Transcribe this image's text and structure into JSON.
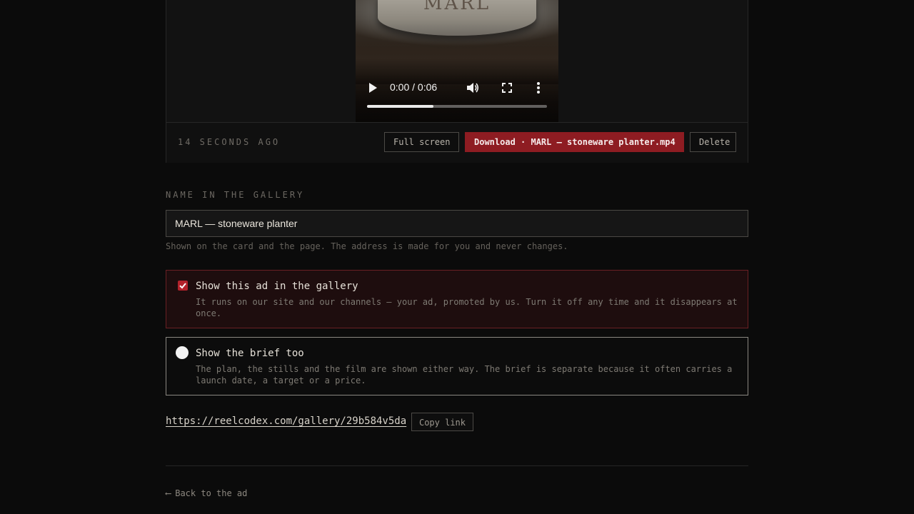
{
  "video": {
    "brand_text": "MARL",
    "time_display": "0:00 / 0:06",
    "progress": 0.37,
    "icons": [
      "play-icon",
      "volume-icon",
      "fullscreen-icon",
      "more-vertical-icon"
    ]
  },
  "card_bar": {
    "timestamp": "14 SECONDS AGO",
    "full_screen_label": "Full screen",
    "download_label": "Download · MARL — stoneware planter.mp4",
    "delete_label": "Delete"
  },
  "name_field": {
    "label": "NAME IN THE GALLERY",
    "value": "MARL — stoneware planter",
    "hint": "Shown on the card and the page. The address is made for you and never changes."
  },
  "options": {
    "gallery": {
      "title": "Show this ad in the gallery",
      "description": "It runs on our site and our channels — your ad, promoted by us. Turn it off any time and it disappears at once.",
      "checked": true
    },
    "brief": {
      "title": "Show the brief too",
      "description": "The plan, the stills and the film are shown either way. The brief is separate because it often carries a launch date, a target or a price.",
      "checked": false
    }
  },
  "share": {
    "url": "https://reelcodex.com/gallery/29b584v5da",
    "copy_label": "Copy link"
  },
  "footer": {
    "back_arrow": "⟵",
    "back_label": "Back to the ad"
  },
  "colors": {
    "accent": "#8e1c22",
    "background": "#0b0b0b"
  }
}
